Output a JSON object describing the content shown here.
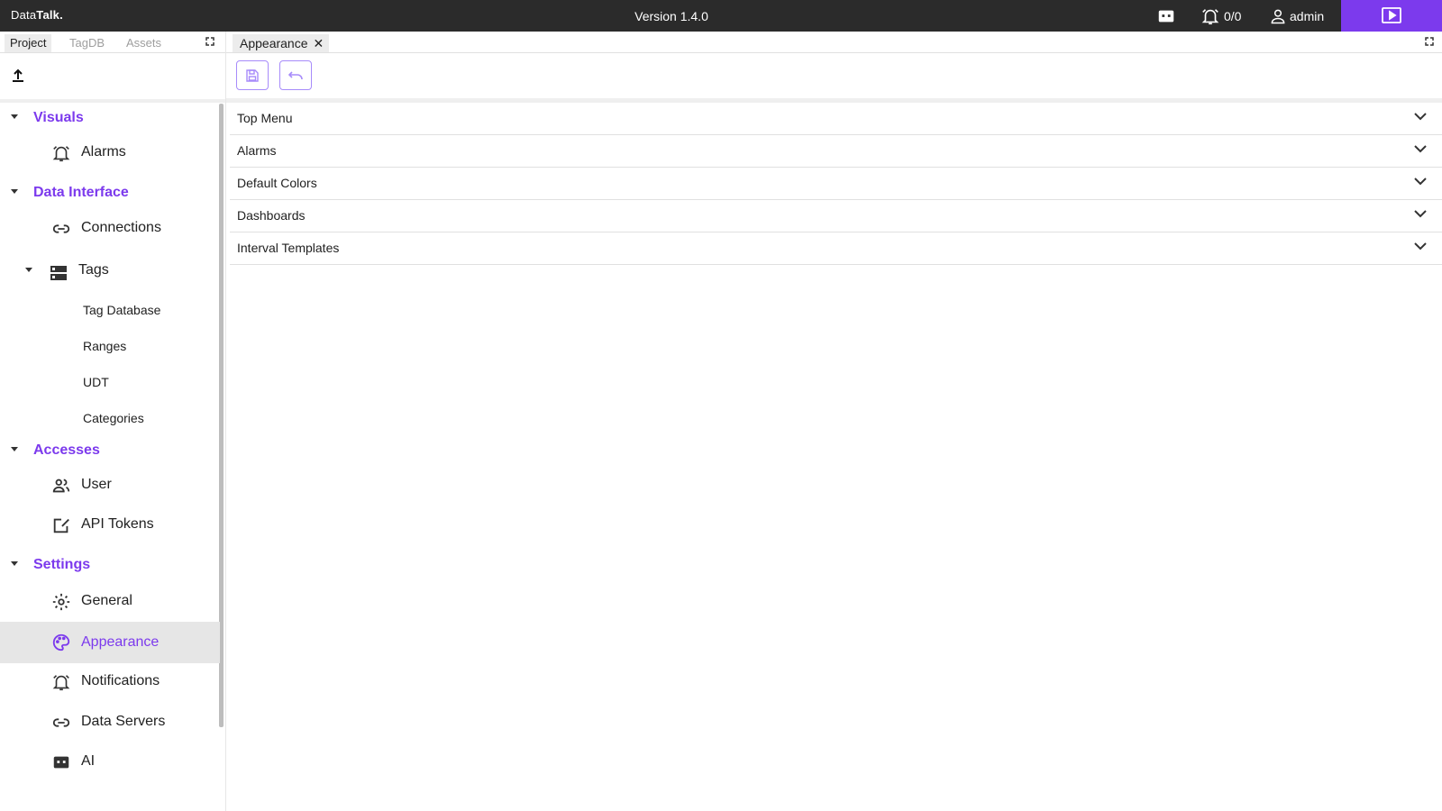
{
  "app": {
    "brand_part1": "Data",
    "brand_part2": "Talk.",
    "version": "Version 1.4.0",
    "alarm_count": "0/0",
    "user": "admin",
    "accent": "#7c3aed"
  },
  "left_tabs": [
    "Project",
    "TagDB",
    "Assets"
  ],
  "sections": {
    "visuals": "Visuals",
    "data_interface": "Data Interface",
    "accesses": "Accesses",
    "settings": "Settings"
  },
  "items": {
    "alarms": "Alarms",
    "connections": "Connections",
    "tags": "Tags",
    "tag_database": "Tag Database",
    "ranges": "Ranges",
    "udt": "UDT",
    "categories": "Categories",
    "user": "User",
    "api_tokens": "API Tokens",
    "general": "General",
    "appearance": "Appearance",
    "notifications": "Notifications",
    "data_servers": "Data Servers",
    "ai": "AI"
  },
  "doc_tab": "Appearance",
  "accordion": [
    "Top Menu",
    "Alarms",
    "Default Colors",
    "Dashboards",
    "Interval Templates"
  ]
}
